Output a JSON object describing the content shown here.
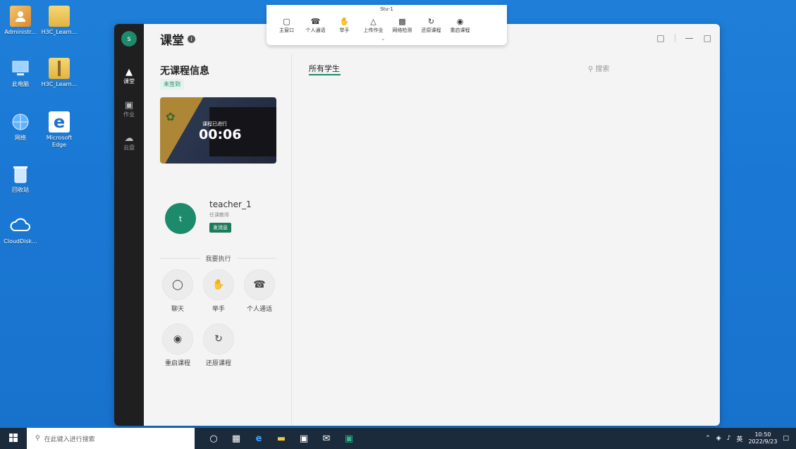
{
  "desktop": {
    "icons": [
      {
        "label": "Administr...",
        "icon": "user-folder-icon"
      },
      {
        "label": "H3C_Learn...",
        "icon": "folder-icon"
      },
      {
        "label": "此电脑",
        "icon": "computer-icon"
      },
      {
        "label": "H3C_Learn...",
        "icon": "zip-folder-icon"
      },
      {
        "label": "网络",
        "icon": "network-icon"
      },
      {
        "label": "Microsoft Edge",
        "icon": "edge-icon"
      },
      {
        "label": "回收站",
        "icon": "recycle-bin-icon"
      },
      {
        "label": "CloudDisk...",
        "icon": "cloud-disk-icon"
      }
    ]
  },
  "toolbar": {
    "title": "Stu-1",
    "items": [
      {
        "label": "主窗口",
        "icon": "window-icon"
      },
      {
        "label": "个人通话",
        "icon": "phone-icon"
      },
      {
        "label": "举手",
        "icon": "hand-icon"
      },
      {
        "label": "上传作业",
        "icon": "upload-icon"
      },
      {
        "label": "网络检测",
        "icon": "signal-icon"
      },
      {
        "label": "还原课程",
        "icon": "restore-icon"
      },
      {
        "label": "重启课程",
        "icon": "restart-icon"
      }
    ]
  },
  "app": {
    "rail": {
      "avatar_letter": "s",
      "items": [
        {
          "label": "课堂",
          "icon": "classroom-icon"
        },
        {
          "label": "作业",
          "icon": "homework-icon"
        },
        {
          "label": "云盘",
          "icon": "cloud-icon"
        }
      ]
    },
    "header": {
      "title": "课堂"
    },
    "course": {
      "title": "无课程信息",
      "status": "未签到",
      "preview_label": "课程已进行",
      "elapsed": "00:06"
    },
    "teacher": {
      "avatar_letter": "t",
      "name": "teacher_1",
      "role": "任课教师",
      "message_button": "发消息"
    },
    "actions_heading": "我要执行",
    "actions": [
      {
        "label": "聊天",
        "icon": "chat-icon"
      },
      {
        "label": "举手",
        "icon": "hand-icon"
      },
      {
        "label": "个人通话",
        "icon": "phone-icon"
      },
      {
        "label": "重启课程",
        "icon": "restart-icon"
      },
      {
        "label": "还原课程",
        "icon": "restore-icon"
      }
    ],
    "tab_all_students": "所有学生",
    "search_placeholder": "搜索"
  },
  "taskbar": {
    "search_placeholder": "在此键入进行搜索",
    "ime": "英",
    "time": "10:50",
    "date": "2022/9/23"
  }
}
